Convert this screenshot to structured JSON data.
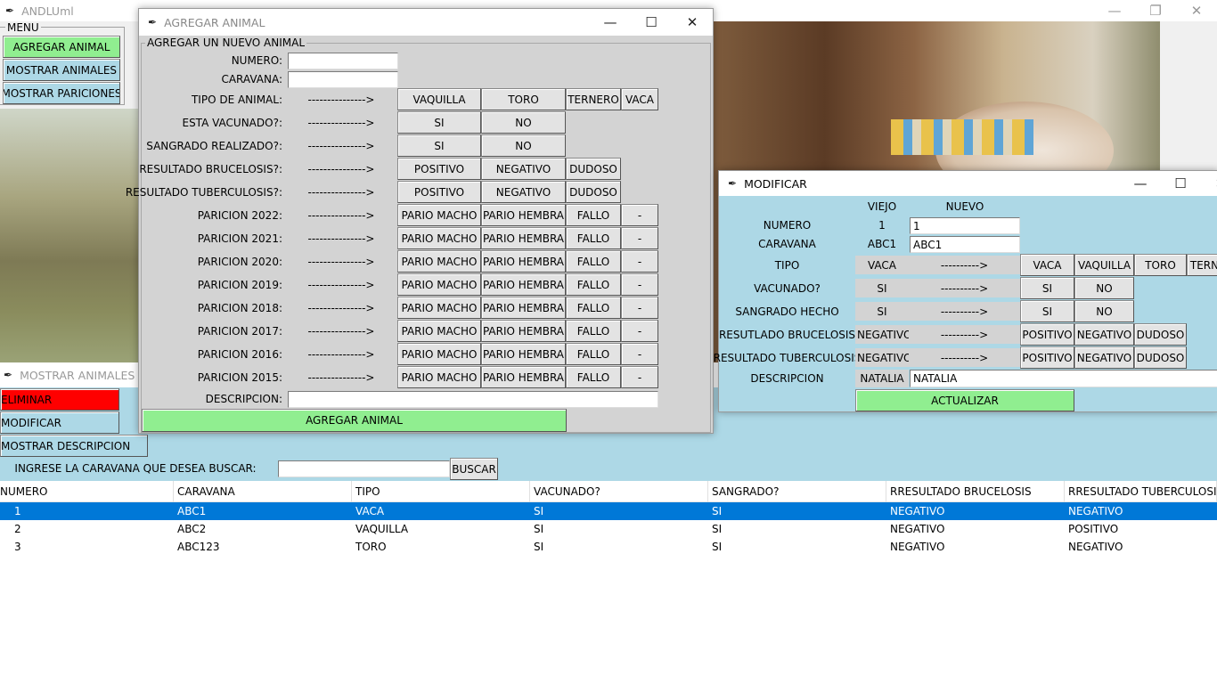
{
  "main": {
    "title": "ANDLUml",
    "menu_label": "MENU",
    "menu_buttons": [
      "AGREGAR ANIMAL",
      "MOSTRAR ANIMALES",
      "MOSTRAR PARICIONES"
    ]
  },
  "mostrar": {
    "title": "MOSTRAR ANIMALES",
    "eliminar": "ELIMINAR",
    "modificar": "MODIFICAR",
    "mostrar_desc": "MOSTRAR DESCRIPCION",
    "search_label": "INGRESE LA CARAVANA QUE DESEA BUSCAR:",
    "search_value": "",
    "buscar": "BUSCAR",
    "columns": [
      "NUMERO",
      "CARAVANA",
      "TIPO",
      "VACUNADO?",
      "SANGRADO?",
      "RRESULTADO BRUCELOSIS",
      "RRESULTADO TUBERCULOSIS"
    ],
    "rows": [
      [
        "1",
        "ABC1",
        "VACA",
        "SI",
        "SI",
        "NEGATIVO",
        "NEGATIVO"
      ],
      [
        "2",
        "ABC2",
        "VAQUILLA",
        "SI",
        "SI",
        "NEGATIVO",
        "POSITIVO"
      ],
      [
        "3",
        "ABC123",
        "TORO",
        "SI",
        "SI",
        "NEGATIVO",
        "NEGATIVO"
      ]
    ],
    "selected_row": 0
  },
  "agregar": {
    "title": "AGREGAR ANIMAL",
    "group_label": "AGREGAR UN NUEVO ANIMAL",
    "numero_label": "NUMERO:",
    "numero_value": "",
    "caravana_label": "CARAVANA:",
    "caravana_value": "",
    "arrow": "--------------->",
    "rows": [
      {
        "label": "TIPO DE ANIMAL:",
        "options": [
          "VAQUILLA",
          "TORO",
          "TERNERO",
          "VACA"
        ]
      },
      {
        "label": "ESTA VACUNADO?:",
        "options": [
          "SI",
          "NO"
        ]
      },
      {
        "label": "SANGRADO REALIZADO?:",
        "options": [
          "SI",
          "NO"
        ]
      },
      {
        "label": "RESULTADO BRUCELOSIS?:",
        "options": [
          "POSITIVO",
          "NEGATIVO",
          "DUDOSO"
        ]
      },
      {
        "label": "RESULTADO TUBERCULOSIS?:",
        "options": [
          "POSITIVO",
          "NEGATIVO",
          "DUDOSO"
        ]
      },
      {
        "label": "PARICION 2022:",
        "options": [
          "PARIO MACHO",
          "PARIO HEMBRA",
          "FALLO",
          "-"
        ]
      },
      {
        "label": "PARICION 2021:",
        "options": [
          "PARIO MACHO",
          "PARIO HEMBRA",
          "FALLO",
          "-"
        ]
      },
      {
        "label": "PARICION 2020:",
        "options": [
          "PARIO MACHO",
          "PARIO HEMBRA",
          "FALLO",
          "-"
        ]
      },
      {
        "label": "PARICION 2019:",
        "options": [
          "PARIO MACHO",
          "PARIO HEMBRA",
          "FALLO",
          "-"
        ]
      },
      {
        "label": "PARICION 2018:",
        "options": [
          "PARIO MACHO",
          "PARIO HEMBRA",
          "FALLO",
          "-"
        ]
      },
      {
        "label": "PARICION 2017:",
        "options": [
          "PARIO MACHO",
          "PARIO HEMBRA",
          "FALLO",
          "-"
        ]
      },
      {
        "label": "PARICION 2016:",
        "options": [
          "PARIO MACHO",
          "PARIO HEMBRA",
          "FALLO",
          "-"
        ]
      },
      {
        "label": "PARICION 2015:",
        "options": [
          "PARIO MACHO",
          "PARIO HEMBRA",
          "FALLO",
          "-"
        ]
      }
    ],
    "descripcion_label": "DESCRIPCION:",
    "descripcion_value": "",
    "submit": "AGREGAR ANIMAL"
  },
  "modificar": {
    "title": "MODIFICAR",
    "viejo": "VIEJO",
    "nuevo": "NUEVO",
    "numero_label": "NUMERO",
    "numero_old": "1",
    "numero_new": "1",
    "caravana_label": "CARAVANA",
    "caravana_old": "ABC1",
    "caravana_new": "ABC1",
    "arrow": "---------->",
    "rows": [
      {
        "label": "TIPO",
        "old": "VACA",
        "options": [
          "VACA",
          "VAQUILLA",
          "TORO",
          "TERN"
        ]
      },
      {
        "label": "VACUNADO?",
        "old": "SI",
        "options": [
          "SI",
          "NO"
        ]
      },
      {
        "label": "SANGRADO HECHO",
        "old": "SI",
        "options": [
          "SI",
          "NO"
        ]
      },
      {
        "label": "RESUTLADO BRUCELOSIS",
        "old": "NEGATIVO",
        "options": [
          "POSITIVO",
          "NEGATIVO",
          "DUDOSO"
        ]
      },
      {
        "label": "RESULTADO TUBERCULOSIS",
        "old": "NEGATIVO",
        "options": [
          "POSITIVO",
          "NEGATIVO",
          "DUDOSO"
        ]
      }
    ],
    "descripcion_label": "DESCRIPCION",
    "descripcion_old": "NATALIA",
    "descripcion_new": "NATALIA",
    "actualizar": "ACTUALIZAR"
  },
  "colors": {
    "green": "#90ee90",
    "blue": "#add8e6",
    "red": "#ff0000",
    "selection": "#0078d7"
  },
  "icons": {
    "app": "feather-icon",
    "minimize": "minimize-icon",
    "maximize": "maximize-icon",
    "restore": "restore-icon",
    "close": "close-icon"
  }
}
